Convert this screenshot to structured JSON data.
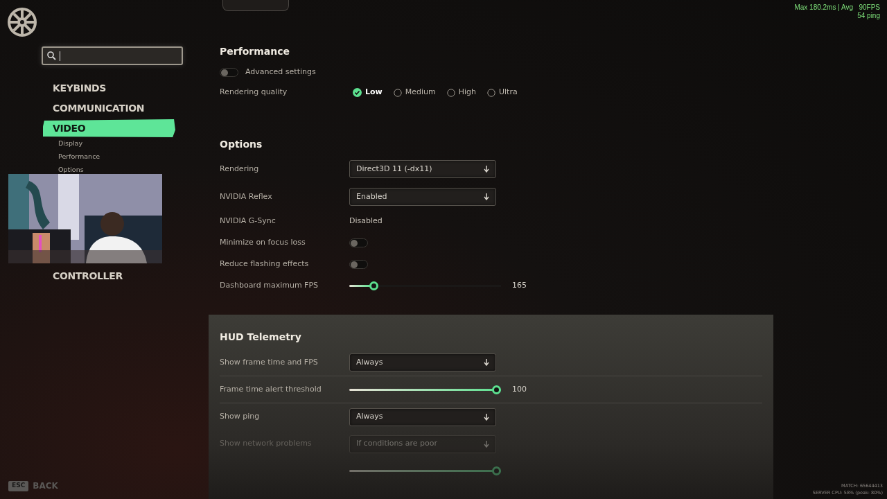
{
  "hud_overlay": {
    "frame_stats": "Max 180.2ms | Avg   90FPS",
    "ping": "54 ping"
  },
  "nav": [
    {
      "label": "KEYBINDS",
      "selected": false
    },
    {
      "label": "COMMUNICATION",
      "selected": false
    },
    {
      "label": "VIDEO",
      "selected": true,
      "children": [
        {
          "label": "Display"
        },
        {
          "label": "Performance"
        },
        {
          "label": "Options"
        }
      ]
    },
    {
      "label": "CONTROLLER",
      "selected": false
    }
  ],
  "sections": [
    {
      "title": "Performance",
      "panel": false,
      "rows": [
        {
          "kind": "switch",
          "label": "Advanced settings",
          "on": false,
          "disabled": false
        },
        {
          "kind": "radio",
          "label": "Rendering quality",
          "disabled": false,
          "options": [
            {
              "label": "Low",
              "selected": true
            },
            {
              "label": "Medium",
              "selected": false
            },
            {
              "label": "High",
              "selected": false
            },
            {
              "label": "Ultra",
              "selected": false
            }
          ]
        }
      ]
    },
    {
      "title": "Options",
      "panel": false,
      "rows": [
        {
          "kind": "dropdown",
          "label": "Rendering",
          "value": "Direct3D 11 (-dx11)",
          "disabled": false
        },
        {
          "kind": "dropdown",
          "label": "NVIDIA Reflex",
          "value": "Enabled",
          "disabled": false
        },
        {
          "kind": "text",
          "label": "NVIDIA G-Sync",
          "value": "Disabled",
          "disabled": false
        },
        {
          "kind": "toggle",
          "label": "Minimize on focus loss",
          "on": false,
          "disabled": false
        },
        {
          "kind": "toggle",
          "label": "Reduce flashing effects",
          "on": false,
          "disabled": false
        },
        {
          "kind": "slider",
          "label": "Dashboard maximum FPS",
          "level": 0.14,
          "reading": "165",
          "disabled": false
        }
      ]
    },
    {
      "title": "HUD Telemetry",
      "panel": true,
      "rows": [
        {
          "kind": "dropdown",
          "label": "Show frame time and FPS",
          "value": "Always",
          "disabled": false
        },
        {
          "kind": "slider",
          "label": "Frame time alert threshold",
          "level": 1,
          "reading": "100",
          "disabled": false
        },
        {
          "kind": "dropdown",
          "label": "Show ping",
          "value": "Always",
          "disabled": false
        },
        {
          "kind": "dropdown",
          "label": "Show network problems",
          "value": "If conditions are poor",
          "disabled": true
        },
        {
          "kind": "slider",
          "level": 1,
          "disabled": true
        }
      ]
    }
  ],
  "back": {
    "key": "ESC",
    "label": "BACK"
  },
  "footer": {
    "match": "MATCH: 65644413",
    "server_cpu": "SERVER CPU: 58% (peak: 80%)"
  }
}
